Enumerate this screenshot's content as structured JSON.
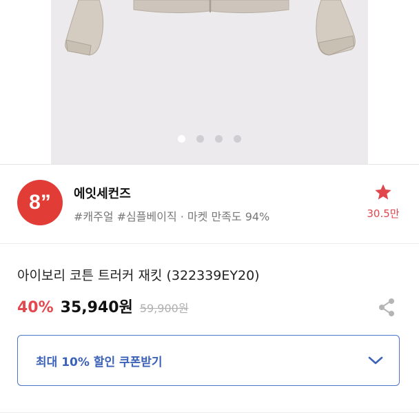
{
  "gallery": {
    "image_alt": "product-photo",
    "slides_count": 4,
    "active_slide": 1
  },
  "shop": {
    "logo_text": "8”",
    "name": "에잇세컨즈",
    "tags": "#캐주얼 #심플베이직 · 마켓 만족도 94%",
    "favorite_count": "30.5만"
  },
  "product": {
    "title": "아이보리 코튼 트러커 재킷 (322339EY20)",
    "discount": "40%",
    "price": "35,940원",
    "original_price": "59,900원"
  },
  "coupon": {
    "label": "최대 10% 할인 쿠폰받기"
  },
  "colors": {
    "accent_red": "#e4484f",
    "logo_red": "#e23c36",
    "coupon_blue": "#3b62b8"
  },
  "icons": {
    "favorite": "star-icon",
    "share": "share-icon",
    "expand": "chevron-down-icon"
  }
}
